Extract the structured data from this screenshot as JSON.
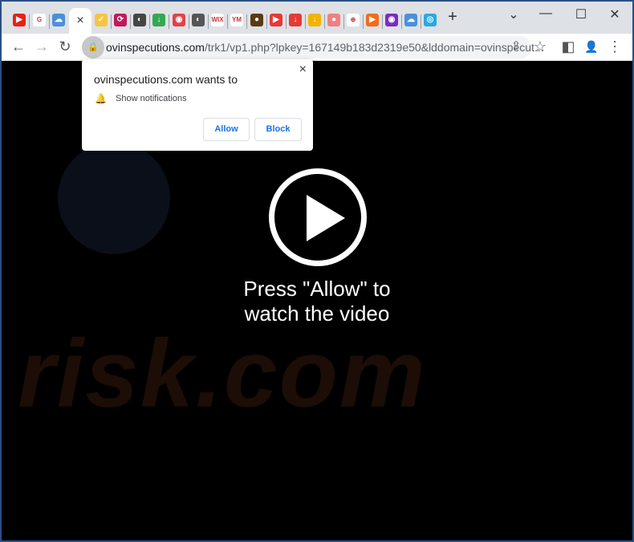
{
  "tabs": {
    "favicons": [
      {
        "icon": "youtube-icon",
        "color": "#e62117",
        "glyph": "▶"
      },
      {
        "icon": "google-icon",
        "color": "#fff",
        "glyph": "G"
      },
      {
        "icon": "cloud-download-icon",
        "color": "#4a90d9",
        "glyph": "☁"
      },
      {
        "icon": "checkmark-icon",
        "color": "#f5c542",
        "glyph": "✓"
      },
      {
        "icon": "sync-icon",
        "color": "#c2185b",
        "glyph": "⟳"
      },
      {
        "icon": "globe-icon",
        "color": "#444",
        "glyph": "◐"
      },
      {
        "icon": "download-icon",
        "color": "#34a853",
        "glyph": "↓"
      },
      {
        "icon": "megaphone-icon",
        "color": "#e0424a",
        "glyph": "◉"
      },
      {
        "icon": "globe-icon",
        "color": "#555",
        "glyph": "◐"
      },
      {
        "icon": "wix-icon",
        "color": "#fff",
        "glyph": "WIX"
      },
      {
        "icon": "ym-icon",
        "color": "#fff",
        "glyph": "YM"
      },
      {
        "icon": "speaker-icon",
        "color": "#5a3a10",
        "glyph": "●"
      },
      {
        "icon": "video-icon",
        "color": "#e53935",
        "glyph": "▶"
      },
      {
        "icon": "download-icon",
        "color": "#e53935",
        "glyph": "↓"
      },
      {
        "icon": "download-icon",
        "color": "#f2b400",
        "glyph": "↓"
      },
      {
        "icon": "stop-icon",
        "color": "#f08080",
        "glyph": "●"
      },
      {
        "icon": "download-icon",
        "color": "#fff",
        "glyph": "⊕"
      },
      {
        "icon": "play-icon",
        "color": "#f26b1d",
        "glyph": "▶"
      },
      {
        "icon": "record-icon",
        "color": "#7b2cbf",
        "glyph": "◉"
      },
      {
        "icon": "cloud-download-icon",
        "color": "#4a90d9",
        "glyph": "☁"
      },
      {
        "icon": "cloud-icon",
        "color": "#29a8e0",
        "glyph": "◎"
      }
    ],
    "active_close": "×",
    "new_tab": "+"
  },
  "window": {
    "dropdown": "⌄",
    "minimize": "—",
    "maximize": "☐",
    "close": "✕"
  },
  "toolbar": {
    "back": "←",
    "forward": "→",
    "reload": "↻",
    "url_host": "ovinspecutions.com",
    "url_rest": "/trk1/vp1.php?lpkey=167149b183d2319e50&lddomain=ovinspecut...",
    "share": "⇪",
    "bookmark": "☆",
    "sidepanel": "◧",
    "profile": "👤",
    "menu": "⋮"
  },
  "popup": {
    "title": "ovinspecutions.com wants to",
    "permission": "Show notifications",
    "allow": "Allow",
    "block": "Block",
    "close": "×"
  },
  "page": {
    "message_line1": "Press \"Allow\" to",
    "message_line2": "watch the video",
    "watermark": "risk.com"
  }
}
